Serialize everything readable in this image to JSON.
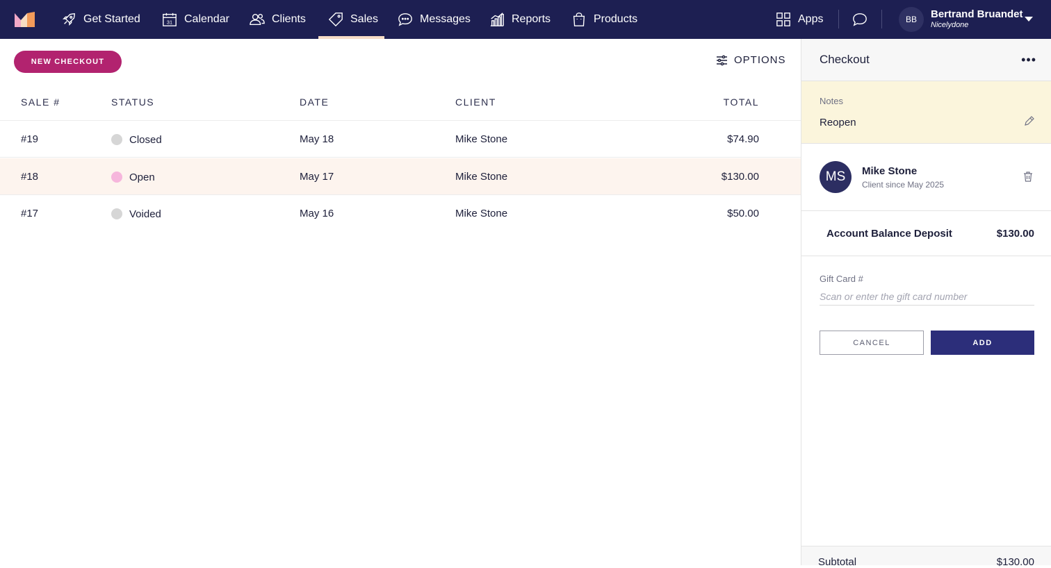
{
  "nav": {
    "items": [
      {
        "label": "Get Started",
        "icon": "rocket-icon"
      },
      {
        "label": "Calendar",
        "icon": "calendar-icon"
      },
      {
        "label": "Clients",
        "icon": "users-icon"
      },
      {
        "label": "Sales",
        "icon": "tag-icon",
        "active": true
      },
      {
        "label": "Messages",
        "icon": "chat-icon"
      },
      {
        "label": "Reports",
        "icon": "bar-chart-icon"
      },
      {
        "label": "Products",
        "icon": "bag-icon"
      }
    ],
    "apps_label": "Apps",
    "calendar_day": "31",
    "user": {
      "initials": "BB",
      "name": "Bertrand Bruandet",
      "org": "Nicelydone"
    }
  },
  "toolbar": {
    "new_checkout": "NEW CHECKOUT",
    "options": "OPTIONS"
  },
  "table": {
    "headers": [
      "SALE #",
      "STATUS",
      "DATE",
      "CLIENT",
      "TOTAL"
    ],
    "rows": [
      {
        "sale": "#19",
        "status": "Closed",
        "status_color": "#d6d6d6",
        "date": "May 18",
        "client": "Mike Stone",
        "total": "$74.90"
      },
      {
        "sale": "#18",
        "status": "Open",
        "status_color": "#f6b6dc",
        "date": "May 17",
        "client": "Mike Stone",
        "total": "$130.00"
      },
      {
        "sale": "#17",
        "status": "Voided",
        "status_color": "#d6d6d6",
        "date": "May 16",
        "client": "Mike Stone",
        "total": "$50.00"
      }
    ]
  },
  "checkout": {
    "title": "Checkout",
    "more": "•••",
    "notes_label": "Notes",
    "notes_value": "Reopen",
    "client_initials": "MS",
    "client_name": "Mike Stone",
    "client_since": "Client since May 2025",
    "item_label": "Account Balance Deposit",
    "item_amount": "$130.00",
    "gift_card_label": "Gift Card #",
    "gift_card_placeholder": "Scan or enter the gift card number",
    "cancel": "CANCEL",
    "add": "ADD",
    "subtotal_label": "Subtotal",
    "subtotal_amount": "$130.00"
  },
  "colors": {
    "nav_bg": "#1d1f52",
    "accent": "#b2236f",
    "primary": "#2c2e7a",
    "notes_bg": "#fbf5dc",
    "row_highlight": "#fdf4ee"
  }
}
